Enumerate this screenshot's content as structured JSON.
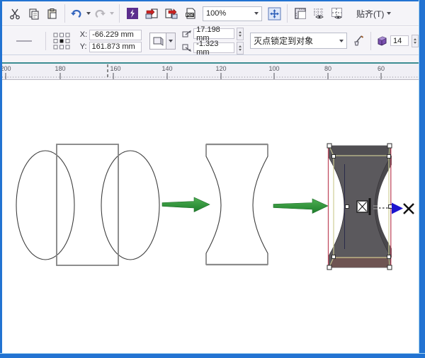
{
  "theme": {
    "window_border_blue": "#2273d2",
    "teal_rule": "#3c8d92",
    "arrow_green": "#2e9639",
    "extrude_gray": "#5b595d",
    "wireframe_khaki": "#cfcd96",
    "guide_red": "#c14e62",
    "vp_arrow_blue": "#1d14cf",
    "app_purple": "#5b2d8e"
  },
  "toolbar": {
    "icons": [
      "cut",
      "copy",
      "paste",
      "undo",
      "undo-menu",
      "redo",
      "redo-menu",
      "application-launcher",
      "import",
      "export",
      "publish-pdf",
      "zoom-fit",
      "ruler-toggle",
      "grid-toggle",
      "guidelines-toggle"
    ],
    "zoom_value": "100%",
    "snap_label": "贴齐(T)"
  },
  "property_bar": {
    "overflow_dash": "—",
    "x_label": "X:",
    "x_value": "-66.229 mm",
    "y_label": "Y:",
    "y_value": "161.873 mm",
    "vp_x_value": "17.198 mm",
    "vp_y_value": "-1.323 mm",
    "vp_mode_value": "灭点锁定到对象",
    "depth_value": "14"
  },
  "ruler": {
    "labels": [
      "200",
      "180",
      "160",
      "140",
      "120",
      "100",
      "80",
      "60"
    ]
  },
  "canvas": {
    "objects": [
      "source-ellipses-and-rectangle",
      "green-arrow-1",
      "trimmed-concave-shape",
      "green-arrow-2",
      "extruded-concave-object",
      "vanishing-point-marker"
    ]
  }
}
